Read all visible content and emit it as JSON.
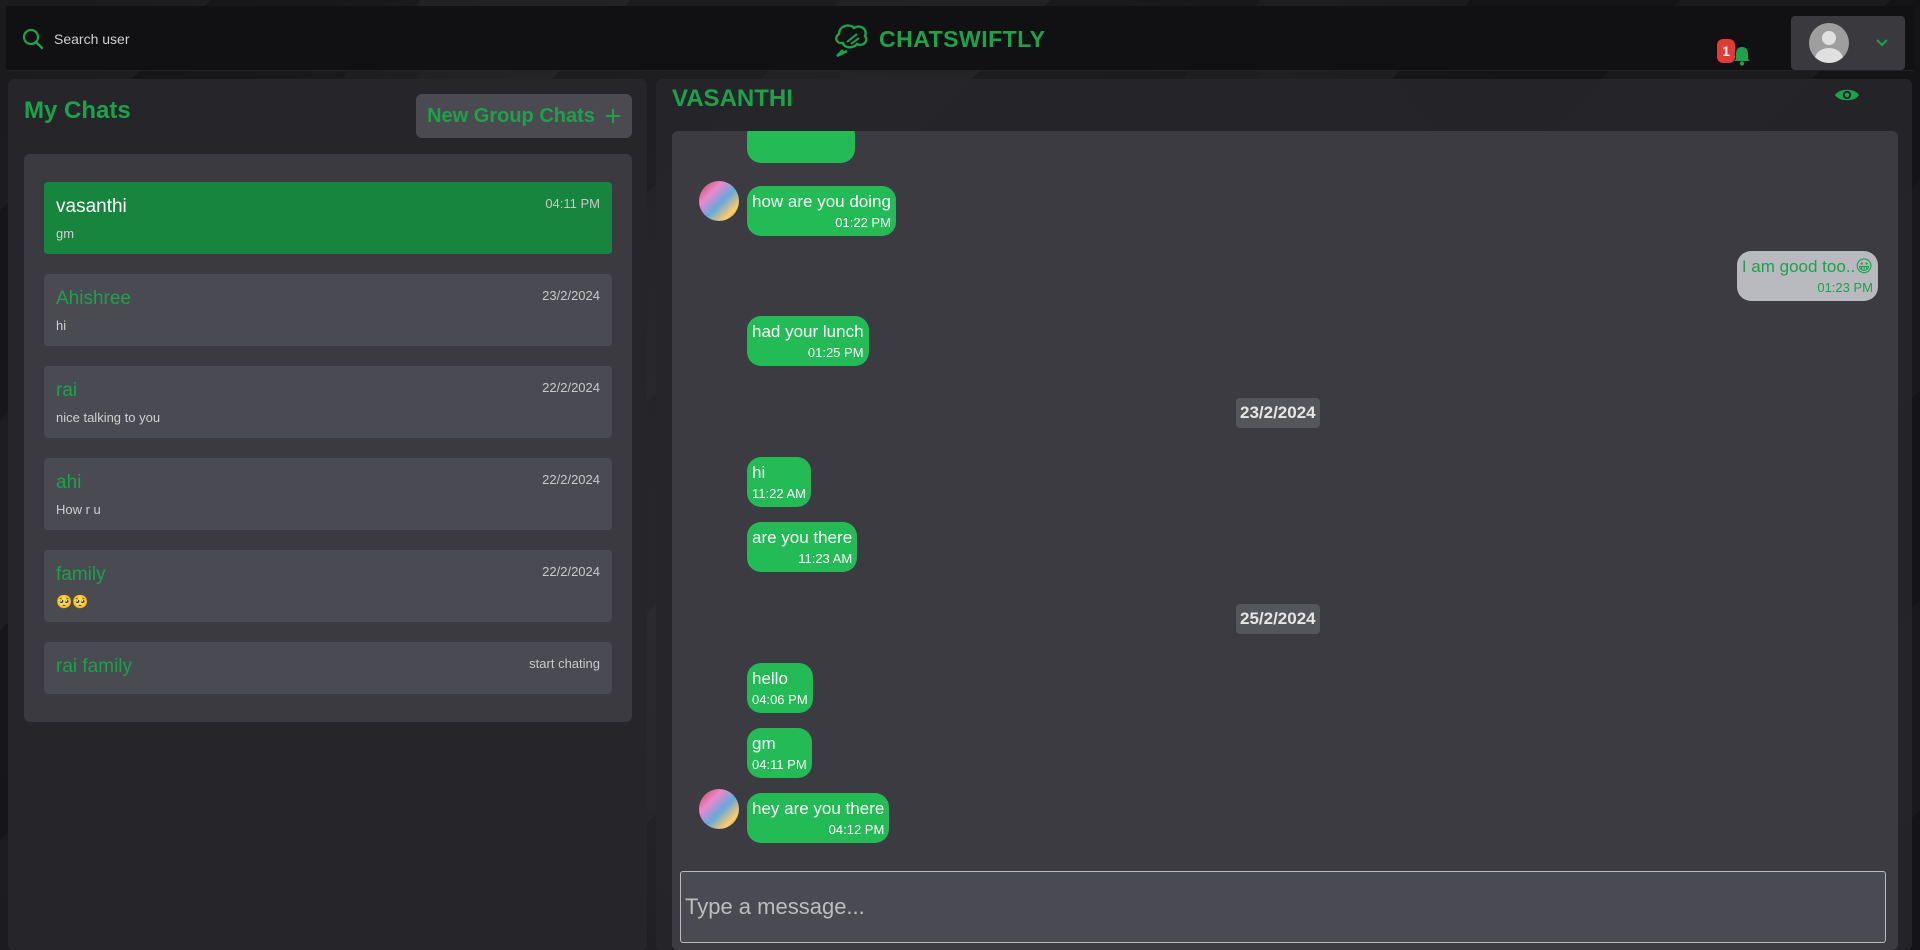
{
  "header": {
    "search_label": "Search user",
    "brand": "CHATSWIFTLY",
    "notification_count": "1",
    "accent": "#1aa34a"
  },
  "sidebar": {
    "title": "My Chats",
    "new_group_label": "New Group Chats",
    "chats": [
      {
        "name": "vasanthi",
        "last": "gm",
        "time": "04:11 PM",
        "active": true
      },
      {
        "name": "Ahishree",
        "last": "hi",
        "time": "23/2/2024"
      },
      {
        "name": "rai",
        "last": "nice talking to you",
        "time": "22/2/2024"
      },
      {
        "name": "ahi",
        "last": "How r u",
        "time": "22/2/2024"
      },
      {
        "name": "family",
        "last": "🥺🥺",
        "time": "22/2/2024"
      },
      {
        "name": "rai family",
        "last": "",
        "time": "start chating"
      }
    ]
  },
  "chat": {
    "title": "VASANTHI",
    "composer_placeholder": "Type a message...",
    "messages": [
      {
        "text": "how are you doing",
        "time": "01:22 PM",
        "mine": false
      },
      {
        "text": "I am good too..😀",
        "time": "01:23 PM",
        "mine": true
      },
      {
        "text": "had your lunch",
        "time": "01:25 PM",
        "mine": false
      },
      {
        "date": "23/2/2024"
      },
      {
        "text": "hi",
        "time": "11:22 AM",
        "mine": false
      },
      {
        "text": "are you there",
        "time": "11:23 AM",
        "mine": false
      },
      {
        "date": "25/2/2024"
      },
      {
        "text": "hello",
        "time": "04:06 PM",
        "mine": false
      },
      {
        "text": "gm",
        "time": "04:11 PM",
        "mine": false
      },
      {
        "text": "hey are you there",
        "time": "04:12 PM",
        "mine": false
      }
    ]
  }
}
